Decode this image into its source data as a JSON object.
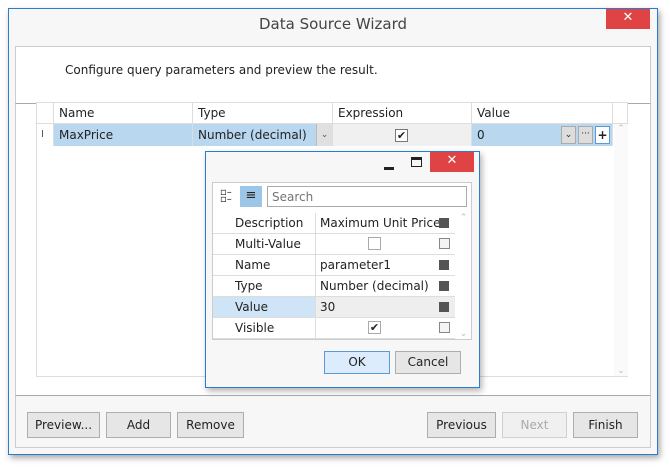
{
  "window": {
    "title": "Data Source Wizard",
    "close_icon": "close-icon"
  },
  "header": {
    "text": "Configure query parameters and preview the result."
  },
  "grid": {
    "columns": [
      "Name",
      "Type",
      "Expression",
      "Value"
    ],
    "rows": [
      {
        "name": "MaxPrice",
        "type": "Number (decimal)",
        "expression": true,
        "value": "0"
      }
    ]
  },
  "popup": {
    "search_placeholder": "Search",
    "properties": [
      {
        "label": "Description",
        "value": "Maximum Unit Price",
        "kind": "text"
      },
      {
        "label": "Multi-Value",
        "value": false,
        "kind": "check"
      },
      {
        "label": "Name",
        "value": "parameter1",
        "kind": "text"
      },
      {
        "label": "Type",
        "value": "Number (decimal)",
        "kind": "text"
      },
      {
        "label": "Value",
        "value": "30",
        "kind": "text"
      },
      {
        "label": "Visible",
        "value": true,
        "kind": "check"
      }
    ],
    "ok_label": "OK",
    "cancel_label": "Cancel"
  },
  "footer": {
    "preview": "Preview...",
    "add": "Add",
    "remove": "Remove",
    "previous": "Previous",
    "next": "Next",
    "finish": "Finish"
  },
  "colors": {
    "accent": "#2b7bd0",
    "selection": "#b9d8f0",
    "close": "#e04343"
  }
}
